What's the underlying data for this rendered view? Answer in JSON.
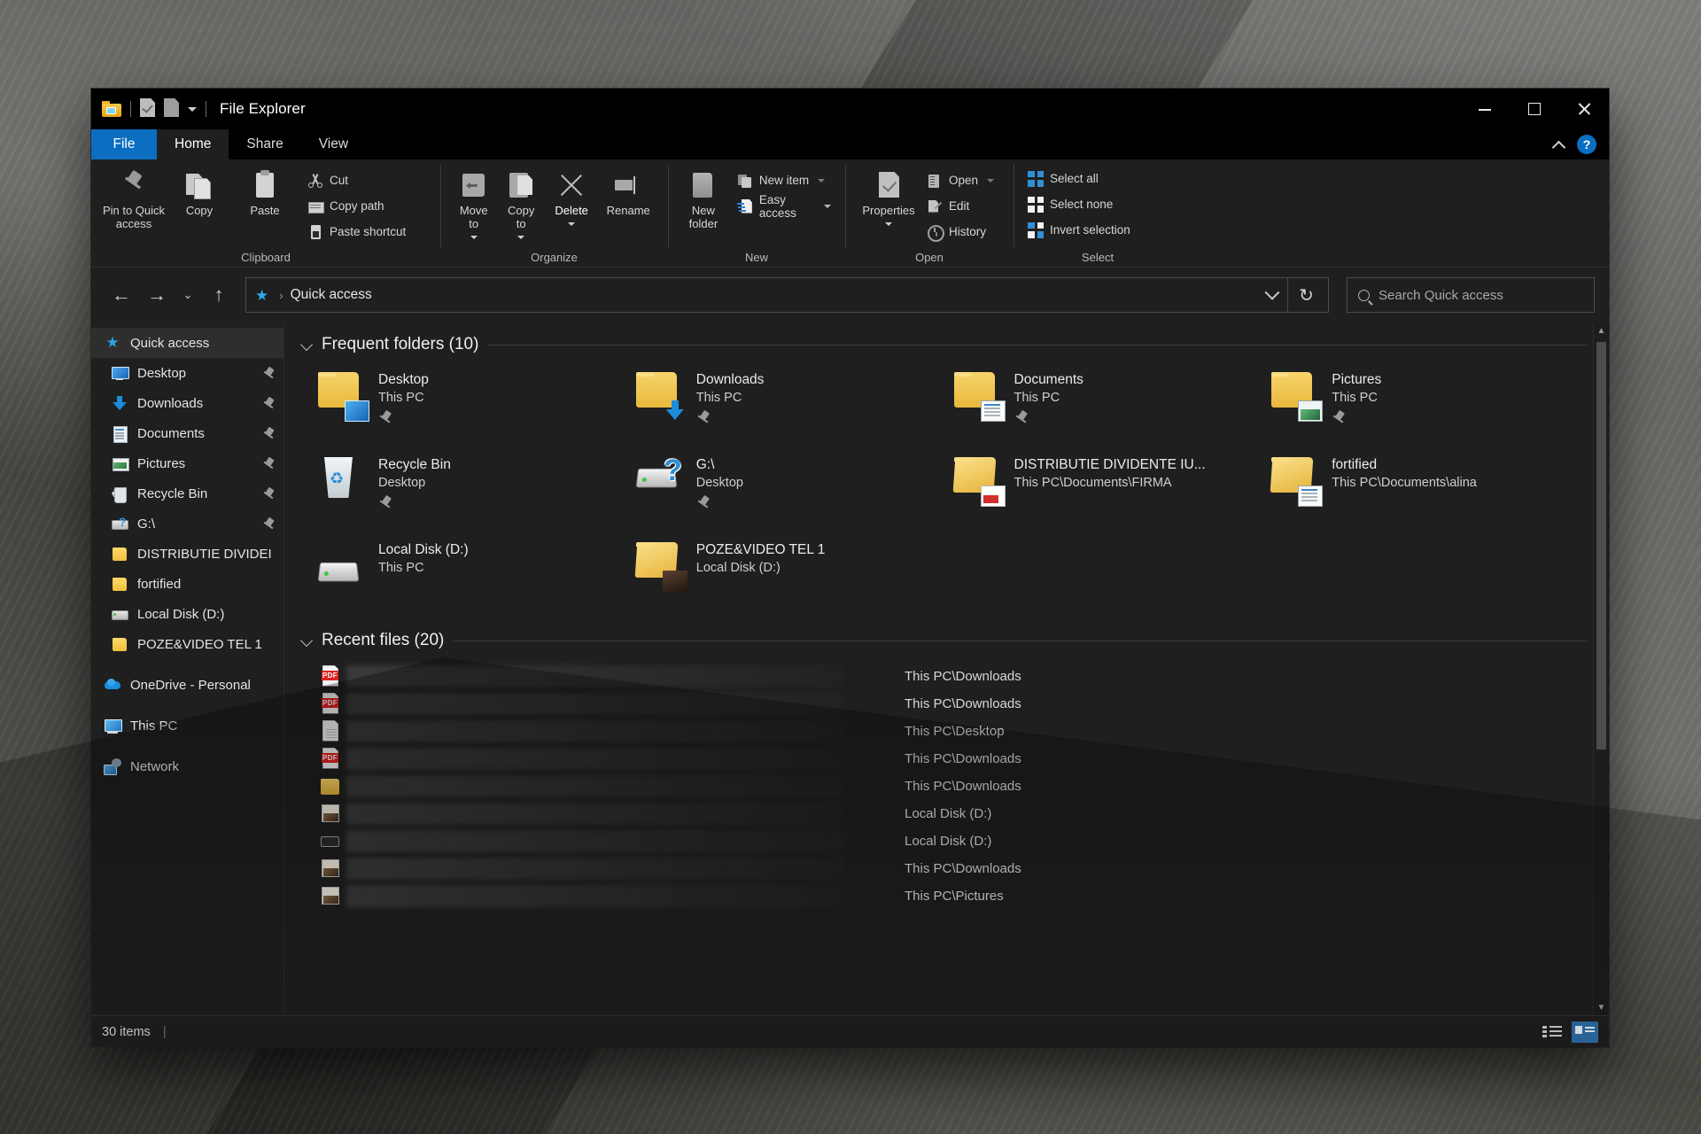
{
  "window": {
    "title": "File Explorer",
    "quick_access_toolbar": [
      "folder-icon",
      "properties-check-icon",
      "new-folder-icon",
      "customize-caret-icon"
    ],
    "controls": {
      "minimize": "–",
      "maximize": "□",
      "close": "✕"
    }
  },
  "ribbon": {
    "tabs": [
      {
        "label": "File",
        "state": "file"
      },
      {
        "label": "Home",
        "state": "active"
      },
      {
        "label": "Share",
        "state": "normal"
      },
      {
        "label": "View",
        "state": "normal"
      }
    ],
    "collapse_label": "^",
    "help_label": "?",
    "groups": [
      {
        "label": "Clipboard",
        "big": [
          {
            "label": "Pin to Quick\naccess",
            "icon": "pin-icon"
          },
          {
            "label": "Copy",
            "icon": "copy-icon"
          },
          {
            "label": "Paste",
            "icon": "paste-icon"
          }
        ],
        "small": [
          {
            "label": "Cut",
            "icon": "scissors-icon"
          },
          {
            "label": "Copy path",
            "icon": "copy-path-icon"
          },
          {
            "label": "Paste shortcut",
            "icon": "paste-shortcut-icon"
          }
        ]
      },
      {
        "label": "Organize",
        "big": [
          {
            "label": "Move\nto",
            "icon": "move-to-icon",
            "caret": true
          },
          {
            "label": "Copy\nto",
            "icon": "copy-to-icon",
            "caret": true
          },
          {
            "label": "Delete",
            "icon": "delete-x-icon",
            "caret": true
          },
          {
            "label": "Rename",
            "icon": "rename-icon"
          }
        ],
        "small": []
      },
      {
        "label": "New",
        "big": [
          {
            "label": "New\nfolder",
            "icon": "new-folder-icon"
          }
        ],
        "small": [
          {
            "label": "New item",
            "icon": "new-item-icon",
            "caret": "dim"
          },
          {
            "label": "Easy access",
            "icon": "easy-access-icon",
            "caret": true
          }
        ]
      },
      {
        "label": "Open",
        "big": [
          {
            "label": "Properties",
            "icon": "properties-icon",
            "caret": true
          }
        ],
        "small": [
          {
            "label": "Open",
            "icon": "open-icon",
            "caret": "dim"
          },
          {
            "label": "Edit",
            "icon": "edit-icon"
          },
          {
            "label": "History",
            "icon": "history-icon"
          }
        ]
      },
      {
        "label": "Select",
        "big": [],
        "small": [
          {
            "label": "Select all",
            "icon": "select-all-icon"
          },
          {
            "label": "Select none",
            "icon": "select-none-icon"
          },
          {
            "label": "Invert selection",
            "icon": "invert-selection-icon"
          }
        ]
      }
    ]
  },
  "navbar": {
    "back": "←",
    "forward": "→",
    "recent_caret": "⌄",
    "up": "↑",
    "breadcrumb_icon": "star-icon",
    "breadcrumb_sep": "›",
    "breadcrumb": "Quick access",
    "refresh": "↻",
    "search_placeholder": "Search Quick access"
  },
  "sidebar": {
    "items": [
      {
        "label": "Quick access",
        "icon": "star-icon",
        "level": "root",
        "selected": true,
        "pinned": false
      },
      {
        "label": "Desktop",
        "icon": "desktop-icon",
        "level": "child",
        "pinned": true
      },
      {
        "label": "Downloads",
        "icon": "downloads-icon",
        "level": "child",
        "pinned": true
      },
      {
        "label": "Documents",
        "icon": "documents-icon",
        "level": "child",
        "pinned": true
      },
      {
        "label": "Pictures",
        "icon": "pictures-icon",
        "level": "child",
        "pinned": true
      },
      {
        "label": "Recycle Bin",
        "icon": "recycle-bin-icon",
        "level": "child",
        "pinned": true
      },
      {
        "label": "G:\\",
        "icon": "drive-question-icon",
        "level": "child",
        "pinned": true
      },
      {
        "label": "DISTRIBUTIE DIVIDEI",
        "icon": "folder-icon",
        "level": "child",
        "pinned": false
      },
      {
        "label": "fortified",
        "icon": "folder-icon",
        "level": "child",
        "pinned": false
      },
      {
        "label": "Local Disk (D:)",
        "icon": "drive-icon",
        "level": "child",
        "pinned": false
      },
      {
        "label": "POZE&VIDEO TEL 1",
        "icon": "folder-icon",
        "level": "child",
        "pinned": false
      },
      {
        "label": "OneDrive - Personal",
        "icon": "onedrive-icon",
        "level": "root",
        "pinned": false,
        "gap_before": true
      },
      {
        "label": "This PC",
        "icon": "this-pc-icon",
        "level": "root",
        "pinned": false,
        "gap_before": true
      },
      {
        "label": "Network",
        "icon": "network-icon",
        "level": "root",
        "pinned": false,
        "gap_before": true
      }
    ]
  },
  "content": {
    "frequent": {
      "title": "Frequent folders (10)",
      "items": [
        {
          "name": "Desktop",
          "sub": "This PC",
          "icon": "folder-desktop-icon",
          "pinned": true
        },
        {
          "name": "Downloads",
          "sub": "This PC",
          "icon": "folder-downloads-icon",
          "pinned": true
        },
        {
          "name": "Documents",
          "sub": "This PC",
          "icon": "folder-documents-icon",
          "pinned": true
        },
        {
          "name": "Pictures",
          "sub": "This PC",
          "icon": "folder-pictures-icon",
          "pinned": true
        },
        {
          "name": "Recycle Bin",
          "sub": "Desktop",
          "icon": "recycle-bin-icon",
          "pinned": true
        },
        {
          "name": "G:\\",
          "sub": "Desktop",
          "icon": "drive-question-icon",
          "pinned": true
        },
        {
          "name": "DISTRIBUTIE DIVIDENTE IU...",
          "sub": "This PC\\Documents\\FIRMA",
          "icon": "folder-pdf-icon",
          "pinned": false
        },
        {
          "name": "fortified",
          "sub": "This PC\\Documents\\alina",
          "icon": "folder-docs-icon",
          "pinned": false
        },
        {
          "name": "Local Disk (D:)",
          "sub": "This PC",
          "icon": "drive-icon",
          "pinned": false
        },
        {
          "name": "POZE&VIDEO TEL 1",
          "sub": "Local Disk (D:)",
          "icon": "folder-photo-icon",
          "pinned": false
        }
      ]
    },
    "recent": {
      "title": "Recent files (20)",
      "rows": [
        {
          "name": "",
          "path": "This PC\\Downloads",
          "icon": "pdf-file-icon"
        },
        {
          "name": "",
          "path": "This PC\\Downloads",
          "icon": "pdf-file-icon"
        },
        {
          "name": "",
          "path": "This PC\\Desktop",
          "icon": "text-file-icon"
        },
        {
          "name": "",
          "path": "This PC\\Downloads",
          "icon": "pdf-file-icon"
        },
        {
          "name": "",
          "path": "This PC\\Downloads",
          "icon": "folder-icon"
        },
        {
          "name": "",
          "path": "Local Disk (D:)",
          "icon": "image-file-icon"
        },
        {
          "name": "",
          "path": "Local Disk (D:)",
          "icon": "video-file-icon"
        },
        {
          "name": "",
          "path": "This PC\\Downloads",
          "icon": "image-file-icon"
        },
        {
          "name": "",
          "path": "This PC\\Pictures",
          "icon": "image-file-icon"
        }
      ]
    }
  },
  "statusbar": {
    "item_count": "30 items",
    "separator": "|",
    "view_details": "details-view-icon",
    "view_tiles": "tiles-view-icon"
  }
}
